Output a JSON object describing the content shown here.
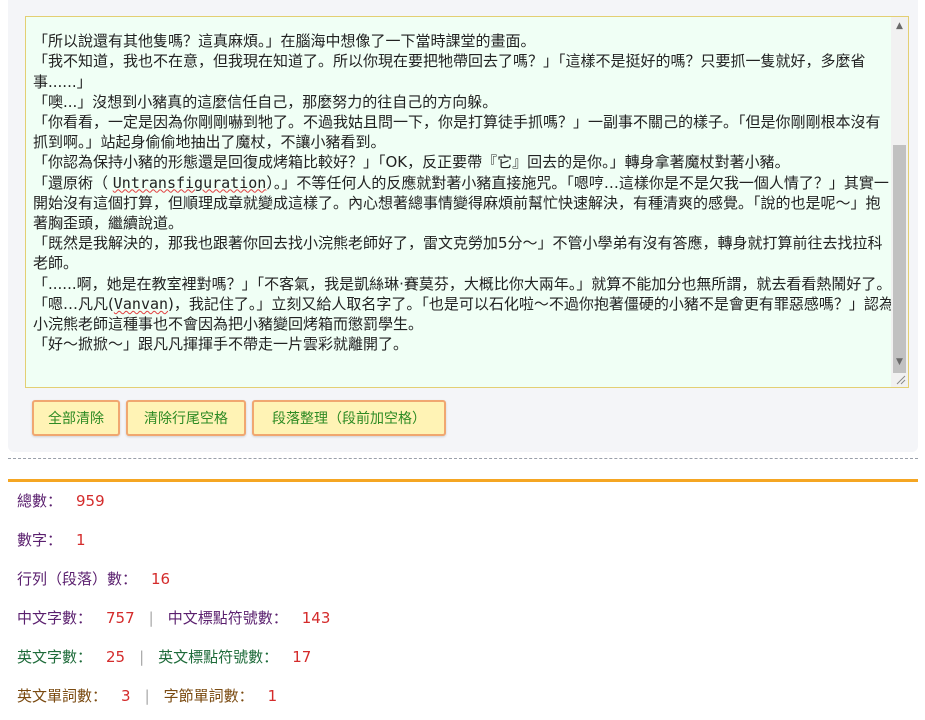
{
  "editor": {
    "lines": [
      "「所以說還有其他隻嗎？這真麻煩。」在腦海中想像了一下當時課堂的畫面。",
      "「我不知道，我也不在意，但我現在知道了。所以你現在要把牠帶回去了嗎？」「這樣不是挺好的嗎？只要抓一隻就好，多麼省事......」",
      "「噢...」沒想到小豬真的這麼信任自己，那麼努力的往自己的方向躲。",
      "「你看看，一定是因為你剛剛嚇到牠了。不過我姑且問一下，你是打算徒手抓嗎？」一副事不關己的樣子。「但是你剛剛根本沒有抓到啊。」站起身偷偷地抽出了魔杖，不讓小豬看到。",
      "「你認為保持小豬的形態還是回復成烤箱比較好？」「OK，反正要帶『它』回去的是你。」轉身拿著魔杖對著小豬。",
      "「還原術（ ",
      "Untransfiguration",
      "）。」不等任何人的反應就對著小豬直接施咒。「嗯哼…這樣你是不是欠我一個人情了？」其實一開始沒有這個打算，但順理成章就變成這樣了。內心想著總事情變得麻煩前幫忙快速解決，有種清爽的感覺。「說的也是呢～」抱著胸歪頭，繼續說道。",
      "「既然是我解決的，那我也跟著你回去找小浣熊老師好了，雷文克勞加5分～」不管小學弟有沒有答應，轉身就打算前往去找拉科老師。",
      "「......啊，她是在教室裡對嗎？」「不客氣，我是凱絲琳·賽莫芬，大概比你大兩年。」就算不能加分也無所謂，就去看看熱鬧好了。",
      "「嗯…凡凡(",
      "Vanvan",
      ")，我記住了。」立刻又給人取名字了。「也是可以石化啦～不過你抱著僵硬的小豬不是會更有罪惡感嗎？」認為小浣熊老師這種事也不會因為把小豬變回烤箱而懲罰學生。",
      "「好～掀掀～」跟凡凡揮揮手不帶走一片雲彩就離開了。"
    ]
  },
  "buttons": {
    "clear_all": "全部清除",
    "clear_trailing": "清除行尾空格",
    "format_paragraph": "段落整理（段前加空格）"
  },
  "stats": {
    "total": {
      "label": "總數：",
      "value": "959"
    },
    "digits": {
      "label": "數字：",
      "value": "1"
    },
    "lines": {
      "label": "行列（段落）數：",
      "value": "16"
    },
    "chinese_chars": {
      "label": "中文字數：",
      "value": "757"
    },
    "chinese_punct": {
      "label": "中文標點符號數：",
      "value": "143"
    },
    "english_chars": {
      "label": "英文字數：",
      "value": "25"
    },
    "english_punct": {
      "label": "英文標點符號數：",
      "value": "17"
    },
    "english_words": {
      "label": "英文單詞數：",
      "value": "3"
    },
    "byte_words": {
      "label": "字節單詞數：",
      "value": "1"
    },
    "separator": "|"
  },
  "colors": {
    "accent_orange": "#f5a623",
    "button_bg": "#fff3b5",
    "button_text": "#2e8b24",
    "value_red": "#d42b2b"
  }
}
